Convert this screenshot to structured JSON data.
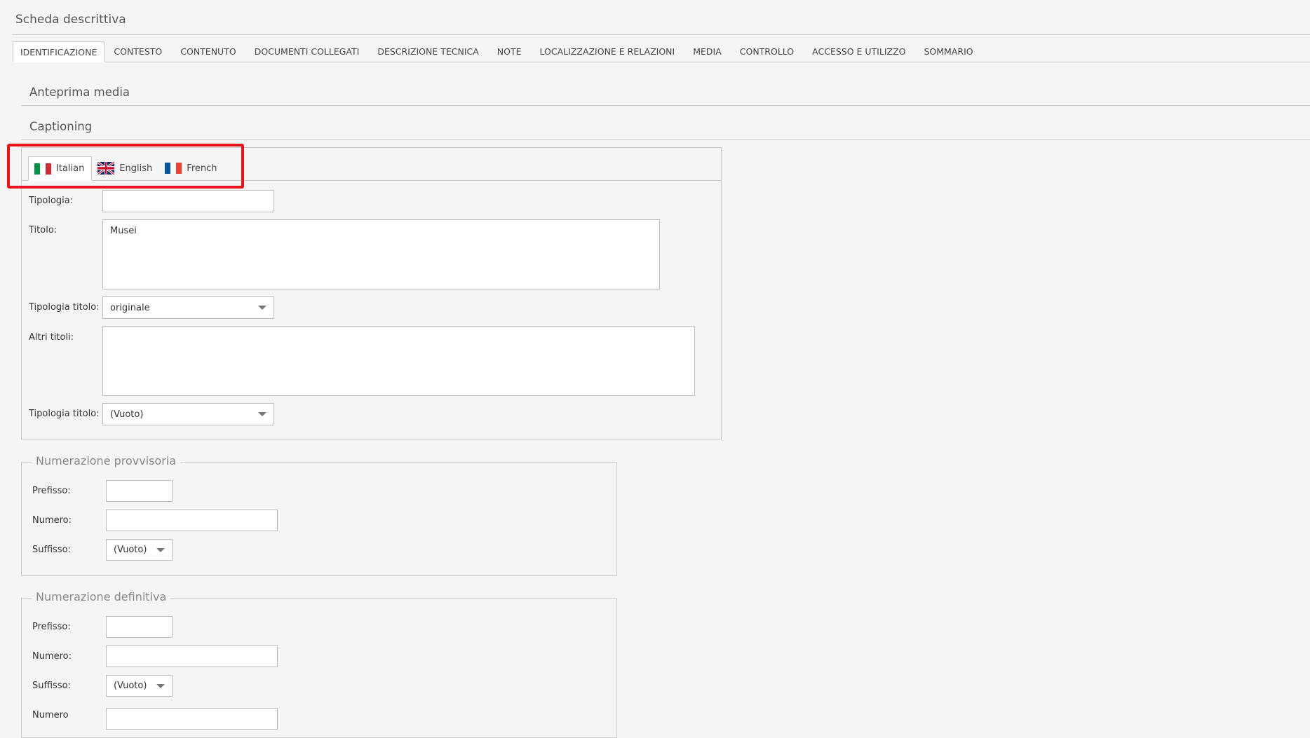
{
  "header": {
    "title": "Scheda descrittiva"
  },
  "main_tabs": [
    {
      "label": "IDENTIFICAZIONE",
      "active": true
    },
    {
      "label": "CONTESTO"
    },
    {
      "label": "CONTENUTO"
    },
    {
      "label": "DOCUMENTI COLLEGATI"
    },
    {
      "label": "DESCRIZIONE TECNICA"
    },
    {
      "label": "NOTE"
    },
    {
      "label": "LOCALIZZAZIONE E RELAZIONI"
    },
    {
      "label": "MEDIA"
    },
    {
      "label": "CONTROLLO"
    },
    {
      "label": "ACCESSO E UTILIZZO"
    },
    {
      "label": "SOMMARIO"
    }
  ],
  "sections": {
    "media_preview": "Anteprima media",
    "captioning": "Captioning"
  },
  "captioning": {
    "languages": [
      {
        "label": "Italian",
        "flag": "italy-flag-icon",
        "active": true
      },
      {
        "label": "English",
        "flag": "uk-flag-icon"
      },
      {
        "label": "French",
        "flag": "france-flag-icon"
      }
    ],
    "fields": {
      "tipologia_label": "Tipologia:",
      "tipologia_value": "",
      "titolo_label": "Titolo:",
      "titolo_value": "Musei",
      "tipologia_titolo_label": "Tipologia titolo:",
      "tipologia_titolo_value": "originale",
      "altri_titoli_label": "Altri titoli:",
      "altri_titoli_value": "",
      "tipologia_titolo2_label": "Tipologia titolo:",
      "tipologia_titolo2_value": "(Vuoto)"
    }
  },
  "numerazione_provvisoria": {
    "legend": "Numerazione provvisoria",
    "prefisso_label": "Prefisso:",
    "prefisso_value": "",
    "numero_label": "Numero:",
    "numero_value": "",
    "suffisso_label": "Suffisso:",
    "suffisso_value": "(Vuoto)"
  },
  "numerazione_definitiva": {
    "legend": "Numerazione definitiva",
    "prefisso_label": "Prefisso:",
    "prefisso_value": "",
    "numero_label": "Numero:",
    "numero_value": "",
    "suffisso_label": "Suffisso:",
    "suffisso_value": "(Vuoto)",
    "partial_label": "Numero"
  },
  "colors": {
    "background": "#f5f5f5",
    "border": "#cccccc",
    "highlight": "#e8141c"
  }
}
